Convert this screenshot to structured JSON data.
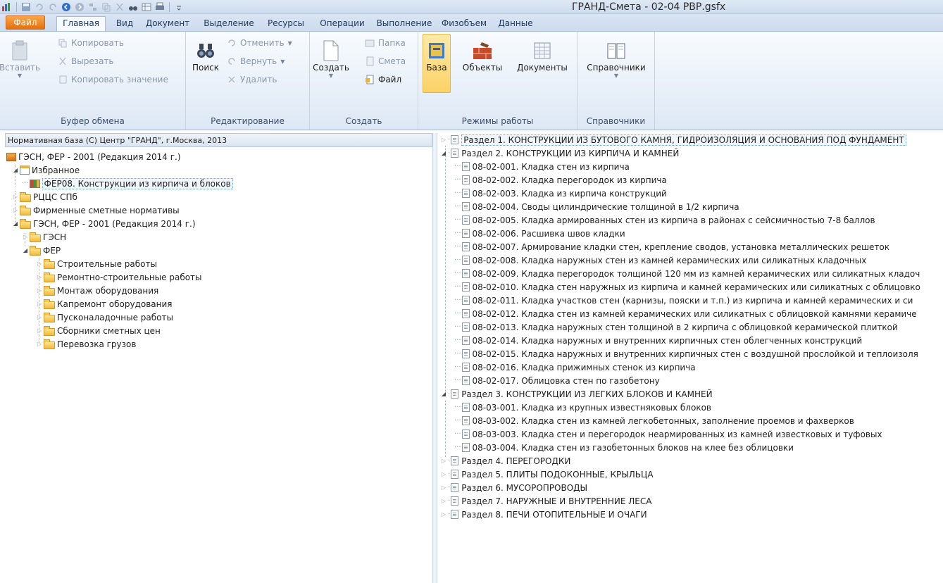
{
  "window": {
    "title": "ГРАНД-Смета - 02-04 РВР.gsfx"
  },
  "ribbon_tabs": [
    "Файл",
    "Главная",
    "Вид",
    "Документ",
    "Выделение",
    "Ресурсы",
    "Операции",
    "Выполнение",
    "Физобъем",
    "Данные"
  ],
  "ribbon": {
    "clipboard": {
      "paste": "Вставить",
      "copy": "Копировать",
      "cut": "Вырезать",
      "copy_value": "Копировать значение",
      "label": "Буфер обмена"
    },
    "editing": {
      "search": "Поиск",
      "undo": "Отменить",
      "redo": "Вернуть",
      "delete": "Удалить",
      "label": "Редактирование"
    },
    "create": {
      "create": "Создать",
      "folder": "Папка",
      "estimate": "Смета",
      "file": "Файл",
      "label": "Создать"
    },
    "modes": {
      "base": "База",
      "objects": "Объекты",
      "documents": "Документы",
      "label": "Режимы работы"
    },
    "references": {
      "references": "Справочники",
      "label": "Справочники"
    }
  },
  "left_panel": {
    "header": "Нормативная база (С) Центр \"ГРАНД\", г.Москва, 2013",
    "tree": [
      "ГЭСН, ФЕР - 2001 (Редакция 2014 г.)",
      "Избранное",
      "ФЕР08. Конструкции из кирпича и блоков",
      "РЦЦС СПб",
      "Фирменные сметные нормативы",
      "ГЭСН, ФЕР - 2001 (Редакция 2014 г.)",
      "ГЭСН",
      "ФЕР",
      "Строительные работы",
      "Ремонтно-строительные работы",
      "Монтаж оборудования",
      "Капремонт оборудования",
      "Пусконаладочные работы",
      "Сборники сметных цен",
      "Перевозка грузов"
    ]
  },
  "right_panel": {
    "tree": [
      "Раздел 1. КОНСТРУКЦИИ ИЗ БУТОВОГО КАМНЯ, ГИДРОИЗОЛЯЦИЯ И ОСНОВАНИЯ ПОД ФУНДАМЕНТ",
      "Раздел 2. КОНСТРУКЦИИ ИЗ КИРПИЧА И КАМНЕЙ",
      "08-02-001. Кладка стен из кирпича",
      "08-02-002. Кладка перегородок из кирпича",
      "08-02-003. Кладка из кирпича конструкций",
      "08-02-004. Своды цилиндрические толщиной в 1/2 кирпича",
      "08-02-005. Кладка армированных стен из кирпича в районах с сейсмичностью 7-8 баллов",
      "08-02-006. Расшивка швов кладки",
      "08-02-007. Армирование кладки стен, крепление сводов, установка металлических решеток",
      "08-02-008. Кладка наружных стен из камней керамических или силикатных кладочных",
      "08-02-009. Кладка перегородок толщиной 120 мм из камней керамических или силикатных кладоч",
      "08-02-010. Кладка стен наружных из кирпича и камней керамических или силикатных с облицовко",
      "08-02-011. Кладка участков стен (карнизы, пояски и т.п.) из кирпича и камней керамических и си",
      "08-02-012. Кладка стен из камней керамических или силикатных с облицовкой камнями керамиче",
      "08-02-013. Кладка наружных стен толщиной в 2 кирпича с облицовкой керамической плиткой",
      "08-02-014. Кладка наружных и внутренних кирпичных стен облегченных конструкций",
      "08-02-015. Кладка наружных и внутренних кирпичных стен с воздушной прослойкой и теплоизоля",
      "08-02-016. Кладка прижимных стенок из кирпича",
      "08-02-017. Облицовка стен по газобетону",
      "Раздел 3. КОНСТРУКЦИИ ИЗ ЛЕГКИХ БЛОКОВ И КАМНЕЙ",
      "08-03-001. Кладка из крупных известняковых блоков",
      "08-03-002. Кладка стен из камней легкобетонных, заполнение проемов и фахверков",
      "08-03-003. Кладка стен и перегородок неармированных из камней известковых и туфовых",
      "08-03-004. Кладка стен из газобетонных блоков на клее без облицовки",
      "Раздел 4. ПЕРЕГОРОДКИ",
      "Раздел 5. ПЛИТЫ ПОДОКОННЫЕ, КРЫЛЬЦА",
      "Раздел 6. МУСОРОПРОВОДЫ",
      "Раздел 7. НАРУЖНЫЕ И ВНУТРЕННИЕ ЛЕСА",
      "Раздел 8. ПЕЧИ ОТОПИТЕЛЬНЫЕ И ОЧАГИ"
    ]
  }
}
